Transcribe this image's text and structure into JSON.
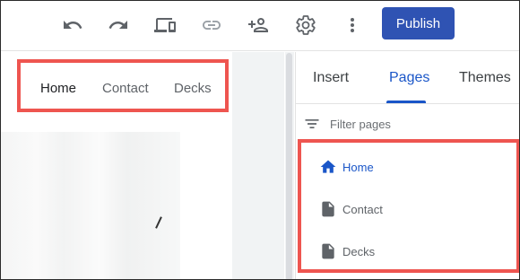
{
  "toolbar": {
    "icons": [
      "undo-icon",
      "redo-icon",
      "preview-icon",
      "link-icon",
      "share-icon",
      "settings-icon",
      "more-vert-icon"
    ],
    "publish_label": "Publish"
  },
  "site_nav": {
    "items": [
      {
        "label": "Home",
        "active": true
      },
      {
        "label": "Contact",
        "active": false
      },
      {
        "label": "Decks",
        "active": false
      }
    ]
  },
  "panel": {
    "tabs": [
      {
        "label": "Insert",
        "active": false
      },
      {
        "label": "Pages",
        "active": true
      },
      {
        "label": "Themes",
        "active": false
      }
    ],
    "filter_placeholder": "Filter pages",
    "pages": [
      {
        "label": "Home",
        "icon": "home-icon",
        "active": true
      },
      {
        "label": "Contact",
        "icon": "document-icon",
        "active": false
      },
      {
        "label": "Decks",
        "icon": "document-icon",
        "active": false
      }
    ]
  },
  "colors": {
    "accent": "#1a56c8",
    "publish": "#2f53b3",
    "highlight": "#ee5550"
  }
}
